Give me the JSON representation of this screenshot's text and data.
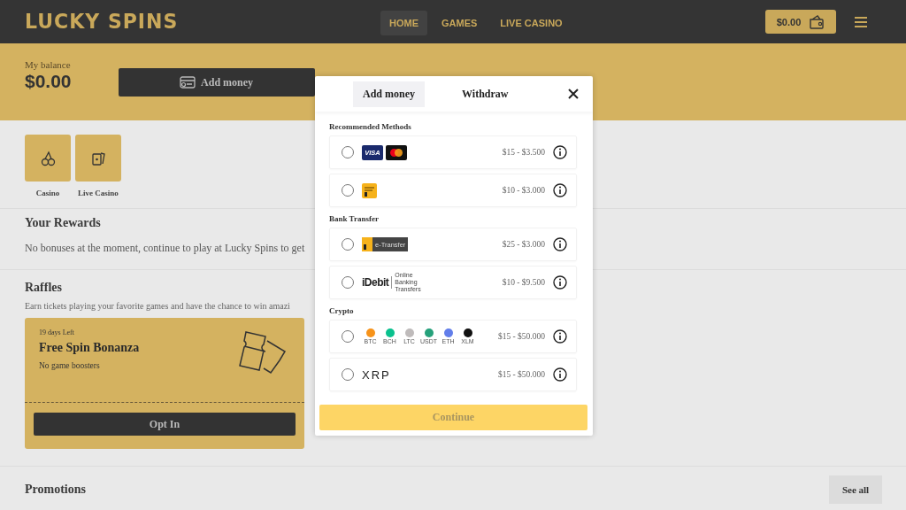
{
  "header": {
    "logo": "LUCKY SPINS",
    "nav": [
      {
        "label": "HOME",
        "selected": true
      },
      {
        "label": "GAMES",
        "selected": false
      },
      {
        "label": "LIVE CASINO",
        "selected": false
      }
    ],
    "wallet": "$0.00"
  },
  "balance": {
    "label": "My balance",
    "amount": "$0.00",
    "add_button": "Add money"
  },
  "categories": [
    {
      "label": "Casino",
      "kind": "cherries"
    },
    {
      "label": "Live Casino",
      "kind": "cards"
    }
  ],
  "rewards": {
    "title": "Your Rewards",
    "text": "No bonuses at the moment, continue to play at Lucky Spins to get"
  },
  "raffles": {
    "title": "Raffles",
    "text": "Earn tickets playing your favorite games and have the chance to win amazi",
    "card": {
      "days_left": "19 days Left",
      "title": "Free Spin Bonanza",
      "boosters": "No game boosters",
      "button": "Opt In"
    }
  },
  "promotions": {
    "title": "Promotions",
    "see_all": "See all"
  },
  "modal": {
    "tabs": [
      {
        "label": "Add money",
        "selected": true
      },
      {
        "label": "Withdraw",
        "selected": false
      }
    ],
    "sections": [
      {
        "title": "Recommended Methods",
        "methods": [
          {
            "kind": "cards",
            "logo_text": "VISA",
            "range": "$15 - $3.500",
            "selected": false
          },
          {
            "kind": "interac",
            "range": "$10 - $3.000",
            "selected": false
          }
        ]
      },
      {
        "title": "Bank Transfer",
        "methods": [
          {
            "kind": "etransfer",
            "logo_text": "e-Transfer",
            "range": "$25 - $3.000",
            "selected": false
          },
          {
            "kind": "idebit",
            "logo_text": "iDebit",
            "logo_subtext": "Online Banking Transfers",
            "range": "$10 - $9.500",
            "selected": false
          }
        ]
      },
      {
        "title": "Crypto",
        "methods": [
          {
            "kind": "crypto",
            "coins": [
              {
                "label": "BTC",
                "color": "#f7931a"
              },
              {
                "label": "BCH",
                "color": "#0ac18e"
              },
              {
                "label": "LTC",
                "color": "#bfbbbb"
              },
              {
                "label": "USDT",
                "color": "#26a17b"
              },
              {
                "label": "ETH",
                "color": "#627eea"
              },
              {
                "label": "XLM",
                "color": "#111111"
              }
            ],
            "range": "$15 - $50.000",
            "selected": false
          },
          {
            "kind": "xrp",
            "logo_text": "XRP",
            "range": "$15 - $50.000",
            "selected": false
          }
        ]
      }
    ],
    "continue_button": {
      "label": "Continue",
      "disabled": true
    }
  }
}
